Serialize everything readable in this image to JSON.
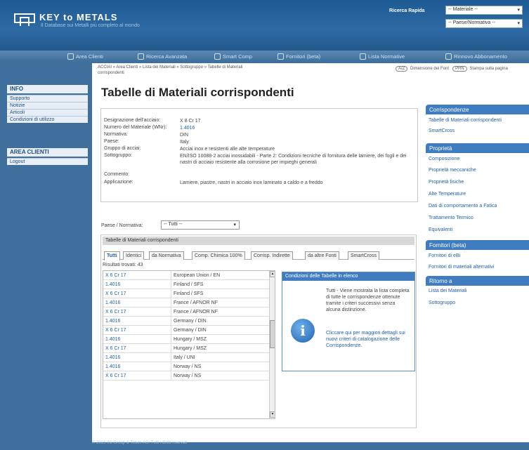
{
  "header": {
    "logo_title": "KEY to METALS",
    "logo_sub": "Il Database sui Metalli più completo al mondo",
    "quick_search_label": "Ricerca Rapida",
    "material_select": "-- Materiale --",
    "country_select": "-- Paese/Normativa --"
  },
  "nav": {
    "items": [
      {
        "label": "Area Clienti",
        "icon": "user-icon"
      },
      {
        "label": "Ricerca Avanzata",
        "icon": "search-icon"
      },
      {
        "label": "Smart Comp",
        "icon": "compare-icon"
      },
      {
        "label": "Fornitori (beta)",
        "icon": "truck-icon"
      },
      {
        "label": "Lista Normative",
        "icon": "list-icon"
      },
      {
        "label": "Rinnovo Abbonamento",
        "icon": "refresh-icon"
      }
    ]
  },
  "sidebar": {
    "head1": "INFO",
    "items1": [
      "Supporto",
      "Notizie",
      "Articoli",
      "Condizioni di utilizzo"
    ],
    "head2": "AREA CLIENTI",
    "items2": [
      "Logout"
    ]
  },
  "breadcrumb": {
    "line1": "ACCIAI  » Area Clienti  » Lista dei Materiali  » Sottogruppo  » Tabelle di Materiali",
    "line2": "corrispondenti"
  },
  "topright": {
    "font_pill": "A/Z",
    "font_label": "Dimensione dei Font",
    "print_pill": "PRN",
    "print_label": "Stampa sulla pagina"
  },
  "page_title": "Tabelle di Materiali corrispondenti",
  "info": {
    "rows": [
      {
        "label": "Designazione dell'acciaio:",
        "value": "X 8 Cr 17",
        "link": false
      },
      {
        "label": "Numero del Materiale (WNr):",
        "value": "1.4016",
        "link": true
      },
      {
        "label": "Normativa:",
        "value": "DIN",
        "link": false
      },
      {
        "label": "Paese:",
        "value": "Italy",
        "link": false
      },
      {
        "label": "Gruppo di acciai:",
        "value": "Acciai inox e resistenti alle alte temperature",
        "link": false
      },
      {
        "label": "Sottogruppo:",
        "value": "EN/ISO 10088-2 acciai inossidabili - Parte 2: Condizioni tecniche di fornitura delle lamiere, dei fogli e dei nastri di acciaio resistente alla corrosione per impieghi generali",
        "link": false
      },
      {
        "label": "Commento:",
        "value": "",
        "link": false
      },
      {
        "label": "Applicazione:",
        "value": "Lamiere, piastre, nastri in acciaio inox laminato a caldo e a freddo",
        "link": false
      }
    ]
  },
  "filter": {
    "label": "Paese / Normativa:",
    "value": "-- Tutti --"
  },
  "table": {
    "header": "Tabelle di Materiali corrispondenti",
    "tabs": [
      "Tutti",
      "Identici",
      "da Normativa",
      "Comp. Chimica 100%",
      "Corrisp. Indirette",
      "da altre Fonti",
      "SmartCross"
    ],
    "results_label": "Risultati trovati: 43",
    "rows": [
      {
        "name": "X 6 Cr 17",
        "country": "European Union / EN"
      },
      {
        "name": "1.4016",
        "country": "Finland / SFS"
      },
      {
        "name": "X 6 Cr 17",
        "country": "Finland / SFS"
      },
      {
        "name": "1.4016",
        "country": "France / AFNOR NF"
      },
      {
        "name": "X 6 Cr 17",
        "country": "France / AFNOR NF"
      },
      {
        "name": "1.4016",
        "country": "Germany / DIN"
      },
      {
        "name": "X 6 Cr 17",
        "country": "Germany / DIN"
      },
      {
        "name": "1.4016",
        "country": "Hungary / MSZ"
      },
      {
        "name": "X 6 Cr 17",
        "country": "Hungary / MSZ"
      },
      {
        "name": "1.4016",
        "country": "Italy / UNI"
      },
      {
        "name": "1.4016",
        "country": "Norway / NS"
      },
      {
        "name": "X 6 Cr 17",
        "country": "Norway / NS"
      }
    ]
  },
  "popup": {
    "title": "Condizioni delle Tabelle in elenco",
    "text1": "Tutti - Viene mostrata la lista completa di tutte le corrispondenze ottenute tramite i criteri successivi senza alcuna distinzione.",
    "text2": "Cliccare qui per maggiori dettagli sui nuovi criteri di catalogazione delle Corrispondenze."
  },
  "right": {
    "sections": [
      {
        "title": "Corrispondenze",
        "items": [
          "Tabelle di Materiali corrispondenti",
          "SmartCross"
        ]
      },
      {
        "title": "Proprietà",
        "items": [
          "Composizione",
          "Proprietà meccaniche",
          "Proprietà fisiche",
          "Alte Temperature",
          "Dati di comportamento a Fatica",
          "Trattamento Termico",
          "Equivalenti"
        ]
      },
      {
        "title": "Fornitori (beta)",
        "items": [
          "Fornitori di eBi",
          "Fornitori di materiali alternativi"
        ]
      },
      {
        "title": "Ritorno a",
        "items": [
          "Lista dei Materiali",
          "Sottogruppo"
        ]
      }
    ]
  },
  "footer": "© 2015 INI Group & Totum AG. Tutti i diritti riservati"
}
